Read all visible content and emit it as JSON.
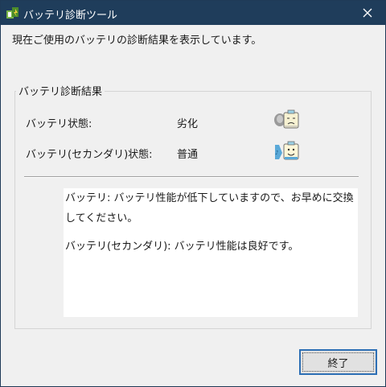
{
  "window": {
    "title": "バッテリ診断ツール",
    "titlebar_color": "#1f3d5b"
  },
  "intro_text": "現在ご使用のバッテリの診断結果を表示しています。",
  "group": {
    "label": "バッテリ診断結果",
    "rows": [
      {
        "label": "バッテリ状態:",
        "value": "劣化",
        "icon": "battery-degraded-icon"
      },
      {
        "label": "バッテリ(セカンダリ)状態:",
        "value": "普通",
        "icon": "battery-normal-icon"
      }
    ]
  },
  "message": {
    "line1": "バッテリ: バッテリ性能が低下していますので、お早めに交換してください。",
    "line2": "バッテリ(セカンダリ): バッテリ性能は良好です。"
  },
  "buttons": {
    "ok_label": "終了"
  }
}
